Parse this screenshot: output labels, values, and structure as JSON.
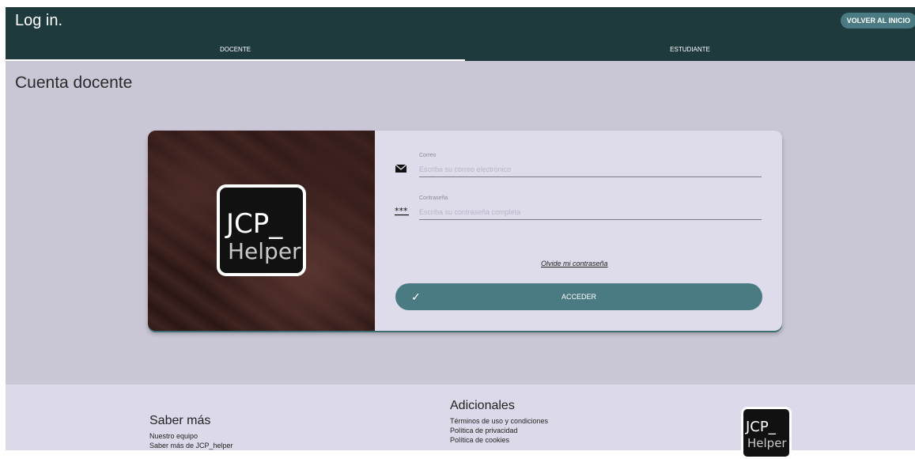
{
  "header": {
    "title": "Log in.",
    "back_button": "VOLVER AL INICIO",
    "tabs": [
      {
        "label": "DOCENTE",
        "active": true
      },
      {
        "label": "ESTUDIANTE",
        "active": false
      }
    ]
  },
  "main": {
    "page_title": "Cuenta docente",
    "logo": {
      "line1": "JCP_",
      "line2": "Helper"
    },
    "form": {
      "email": {
        "label": "Correo",
        "placeholder": "Escriba su correo electrónico",
        "icon": "envelope-icon"
      },
      "password": {
        "label": "Contraseña",
        "placeholder": "Escriba su contraseña completa",
        "icon": "password-dots-icon"
      },
      "forgot_link": "Olvide mi contraseña",
      "submit": {
        "label": "ACCEDER",
        "icon": "check-icon"
      }
    }
  },
  "footer": {
    "saber_mas": {
      "heading": "Saber más",
      "links": [
        "Nuestro equipo",
        "Saber más de JCP_helper"
      ]
    },
    "adicionales": {
      "heading": "Adicionales",
      "links": [
        "Términos de uso y condiciones",
        "Política de privacidad",
        "Política de cookies"
      ]
    },
    "logo": {
      "line1": "JCP_",
      "line2": "Helper"
    }
  },
  "colors": {
    "topbar": "#1f3a3d",
    "accent": "#4b7b82",
    "main_bg": "#c9c6d5",
    "card_bg": "#dedbeb",
    "footer_bg": "#dcdaea"
  }
}
